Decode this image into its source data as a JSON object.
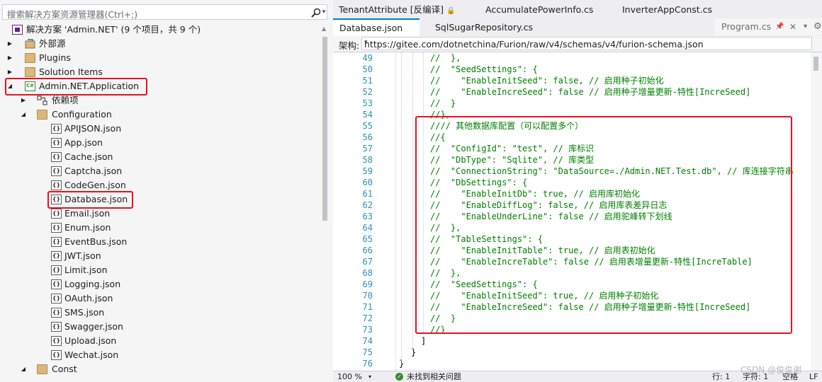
{
  "solution_explorer": {
    "search_placeholder": "搜索解决方案资源管理器(Ctrl+;)",
    "solution_label": "解决方案 'Admin.NET' (9 个项目，共 9 个)",
    "items": [
      {
        "label": "外部源"
      },
      {
        "label": "Plugins"
      },
      {
        "label": "Solution Items"
      },
      {
        "label": "Admin.NET.Application"
      },
      {
        "label": "依赖项"
      },
      {
        "label": "Configuration"
      },
      {
        "label": "APIJSON.json"
      },
      {
        "label": "App.json"
      },
      {
        "label": "Cache.json"
      },
      {
        "label": "Captcha.json"
      },
      {
        "label": "CodeGen.json"
      },
      {
        "label": "Database.json"
      },
      {
        "label": "Email.json"
      },
      {
        "label": "Enum.json"
      },
      {
        "label": "EventBus.json"
      },
      {
        "label": "JWT.json"
      },
      {
        "label": "Limit.json"
      },
      {
        "label": "Logging.json"
      },
      {
        "label": "OAuth.json"
      },
      {
        "label": "SMS.json"
      },
      {
        "label": "Swagger.json"
      },
      {
        "label": "Upload.json"
      },
      {
        "label": "Wechat.json"
      },
      {
        "label": "Const"
      }
    ]
  },
  "editor": {
    "tabs_row1": [
      "TenantAttribute [反编译]",
      "AccumulatePowerInfo.cs",
      "InverterAppConst.cs"
    ],
    "tabs_row2": [
      "Database.json",
      "SqlSugarRepository.cs",
      "Program.cs"
    ],
    "schema_label": "架构:",
    "schema_url": "https://gitee.com/dotnetchina/Furion/raw/v4/schemas/v4/furion-schema.json",
    "lines": [
      {
        "n": "49",
        "t": "//  },"
      },
      {
        "n": "50",
        "t": "//  \"SeedSettings\": {"
      },
      {
        "n": "51",
        "t": "//    \"EnableInitSeed\": false, // 启用种子初始化"
      },
      {
        "n": "52",
        "t": "//    \"EnableIncreSeed\": false // 启用种子增量更新-特性[IncreSeed]"
      },
      {
        "n": "53",
        "t": "//  }"
      },
      {
        "n": "54",
        "t": "//},"
      },
      {
        "n": "55",
        "t": "//// 其他数据库配置（可以配置多个）"
      },
      {
        "n": "56",
        "t": "//{"
      },
      {
        "n": "57",
        "t": "//  \"ConfigId\": \"test\", // 库标识"
      },
      {
        "n": "58",
        "t": "//  \"DbType\": \"Sqlite\", // 库类型"
      },
      {
        "n": "59",
        "t": "//  \"ConnectionString\": \"DataSource=./Admin.NET.Test.db\", // 库连接字符串"
      },
      {
        "n": "60",
        "t": "//  \"DbSettings\": {"
      },
      {
        "n": "61",
        "t": "//    \"EnableInitDb\": true, // 启用库初始化"
      },
      {
        "n": "62",
        "t": "//    \"EnableDiffLog\": false, // 启用库表差异日志"
      },
      {
        "n": "63",
        "t": "//    \"EnableUnderLine\": false // 启用驼峰转下划线"
      },
      {
        "n": "64",
        "t": "//  },"
      },
      {
        "n": "65",
        "t": "//  \"TableSettings\": {"
      },
      {
        "n": "66",
        "t": "//    \"EnableInitTable\": true, // 启用表初始化"
      },
      {
        "n": "67",
        "t": "//    \"EnableIncreTable\": false // 启用表增量更新-特性[IncreTable]"
      },
      {
        "n": "68",
        "t": "//  },"
      },
      {
        "n": "69",
        "t": "//  \"SeedSettings\": {"
      },
      {
        "n": "70",
        "t": "//    \"EnableInitSeed\": true, // 启用种子初始化"
      },
      {
        "n": "71",
        "t": "//    \"EnableIncreSeed\": false // 启用种子增量更新-特性[IncreSeed]"
      },
      {
        "n": "72",
        "t": "//  }"
      },
      {
        "n": "73",
        "t": "//}"
      },
      {
        "n": "74",
        "t": "]"
      },
      {
        "n": "75",
        "t": "}"
      },
      {
        "n": "76",
        "t": "}"
      }
    ]
  },
  "status_bar": {
    "zoom": "100 %",
    "issues": "未找到相关问题",
    "position": "行: 1",
    "char": "字符: 1",
    "whitespace": "空格",
    "eol": "LF",
    "watermark": "CSDN @俊俊谢"
  },
  "colors": {
    "highlight": "#e81123",
    "comment": "#008000",
    "line_number": "#2b91af"
  }
}
